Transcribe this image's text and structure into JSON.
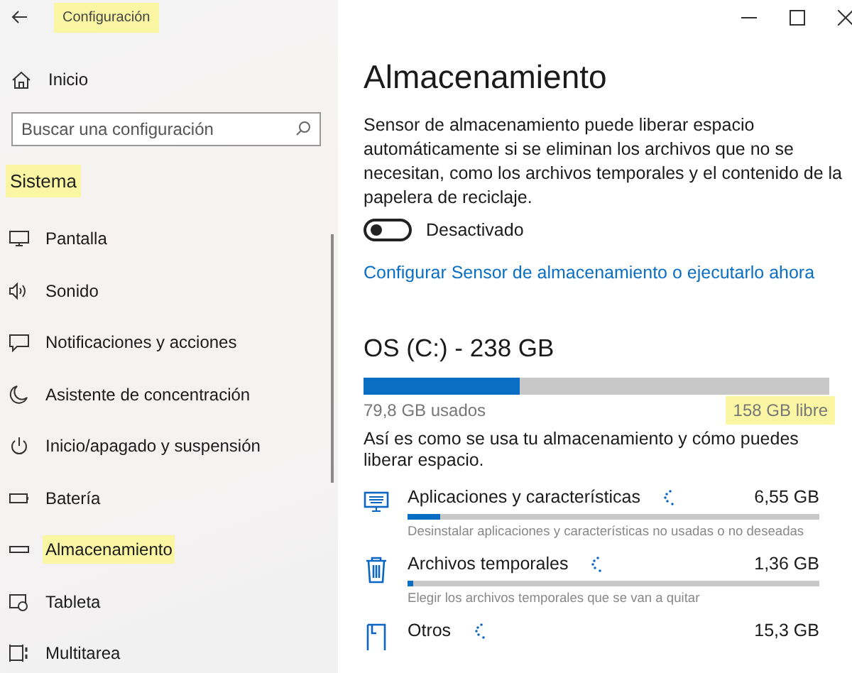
{
  "window": {
    "title": "Configuración",
    "title_highlighted": true
  },
  "sidebar": {
    "home": "Inicio",
    "search": {
      "placeholder": "Buscar una configuración"
    },
    "section": {
      "label": "Sistema",
      "highlighted": true
    },
    "items": [
      {
        "label": "Pantalla",
        "highlighted": false
      },
      {
        "label": "Sonido",
        "highlighted": false
      },
      {
        "label": "Notificaciones y acciones",
        "highlighted": false
      },
      {
        "label": "Asistente de concentración",
        "highlighted": false
      },
      {
        "label": "Inicio/apagado y suspensión",
        "highlighted": false
      },
      {
        "label": "Batería",
        "highlighted": false
      },
      {
        "label": "Almacenamiento",
        "highlighted": true
      },
      {
        "label": "Tableta",
        "highlighted": false
      },
      {
        "label": "Multitarea",
        "highlighted": false
      }
    ]
  },
  "page": {
    "title": "Almacenamiento",
    "description": "Sensor de almacenamiento puede liberar espacio automáticamente si se eliminan los archivos que no se necesitan, como los archivos temporales y el contenido de la papelera de reciclaje.",
    "toggle": {
      "on": false,
      "label": "Desactivado"
    },
    "link": "Configurar Sensor de almacenamiento o ejecutarlo ahora",
    "drive": {
      "name": "OS (C:) - 238 GB",
      "level": 0.335,
      "used": "79,8 GB usados",
      "free": "158 GB libre",
      "free_highlighted": true
    },
    "intro": "Así es como se usa tu almacenamiento y cómo puedes liberar espacio.",
    "categories": [
      {
        "name": "Aplicaciones y características",
        "size": "6,55 GB",
        "level": 0.08,
        "hint": "Desinstalar aplicaciones y características no usadas o no deseadas"
      },
      {
        "name": "Archivos temporales",
        "size": "1,36 GB",
        "level": 0.015,
        "hint": "Elegir los archivos temporales que se van a quitar"
      },
      {
        "name": "Otros",
        "size": "15,3 GB"
      }
    ]
  }
}
